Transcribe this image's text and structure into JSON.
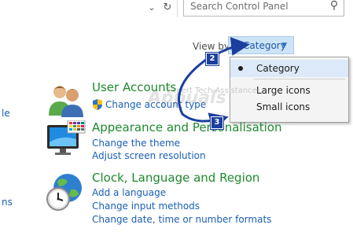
{
  "toolbar": {
    "search_placeholder": "Search Control Panel",
    "icons": [
      "chevron-down-icon",
      "refresh-icon",
      "search-icon"
    ]
  },
  "view_by": {
    "label": "View by:",
    "selected": "Category"
  },
  "view_menu": {
    "items": [
      {
        "label": "Category",
        "selected": true
      },
      {
        "label": "Large icons",
        "selected": false
      },
      {
        "label": "Small icons",
        "selected": false
      }
    ]
  },
  "left_edge": {
    "link1": "le",
    "link2": "ns"
  },
  "categories": [
    {
      "title": "User Accounts",
      "icon": "user-accounts-icon",
      "links": [
        "Change account type"
      ]
    },
    {
      "title": "Appearance and Personalisation",
      "icon": "appearance-icon",
      "links": [
        "Change the theme",
        "Adjust screen resolution"
      ]
    },
    {
      "title": "Clock, Language and Region",
      "icon": "clock-globe-icon",
      "links": [
        "Add a language",
        "Change input methods",
        "Change date, time or number formats"
      ]
    }
  ],
  "annotations": {
    "badge1": "2",
    "badge2": "3",
    "watermark_small": "Expert Tech Assistance!",
    "watermark_big": "Appuals"
  },
  "colors": {
    "link": "#1a5fb4",
    "category_title": "#1e8a2e",
    "annotation": "#1c3f9e",
    "viewby_bg": "#cfe3f7"
  }
}
